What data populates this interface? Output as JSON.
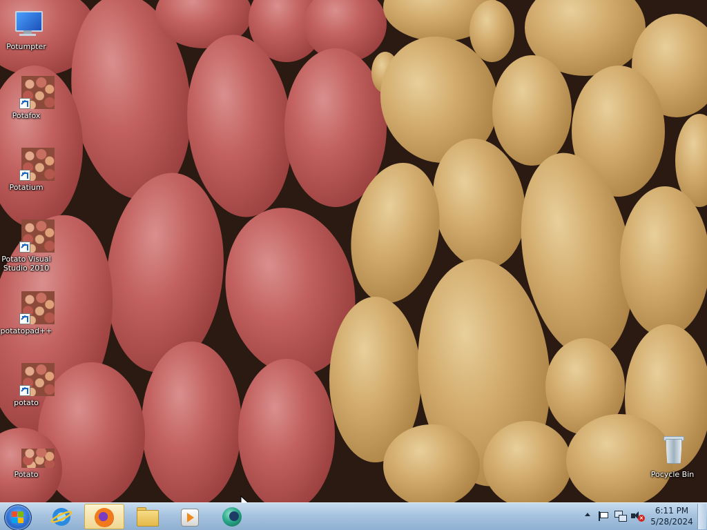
{
  "desktop": {
    "icons": [
      {
        "label": "Potumpter",
        "icon": "computer-icon"
      },
      {
        "label": "Potafox",
        "icon": "potato-shortcut-icon"
      },
      {
        "label": "Potatium",
        "icon": "potato-shortcut-icon"
      },
      {
        "label": "Potato Visual Studio 2010",
        "icon": "potato-shortcut-icon"
      },
      {
        "label": "potatopad++",
        "icon": "potato-shortcut-icon"
      },
      {
        "label": "potato",
        "icon": "potato-shortcut-icon"
      },
      {
        "label": "Potato",
        "icon": "potato-image-icon"
      },
      {
        "label": "Pocycle Bin",
        "icon": "recycle-bin-icon"
      }
    ]
  },
  "taskbar": {
    "start": {
      "icon": "windows-start-orb-icon"
    },
    "pinned": [
      {
        "icon": "internet-explorer-icon",
        "active": false
      },
      {
        "icon": "firefox-icon",
        "active": true
      },
      {
        "icon": "file-explorer-folder-icon",
        "active": false
      },
      {
        "icon": "media-player-icon",
        "active": false
      },
      {
        "icon": "globe-app-icon",
        "active": false
      }
    ],
    "tray": {
      "icons": [
        "show-hidden-icons-arrow-icon",
        "action-center-flag-icon",
        "network-icon",
        "volume-muted-icon"
      ],
      "time": "6:11 PM",
      "date": "5/28/2024"
    }
  }
}
